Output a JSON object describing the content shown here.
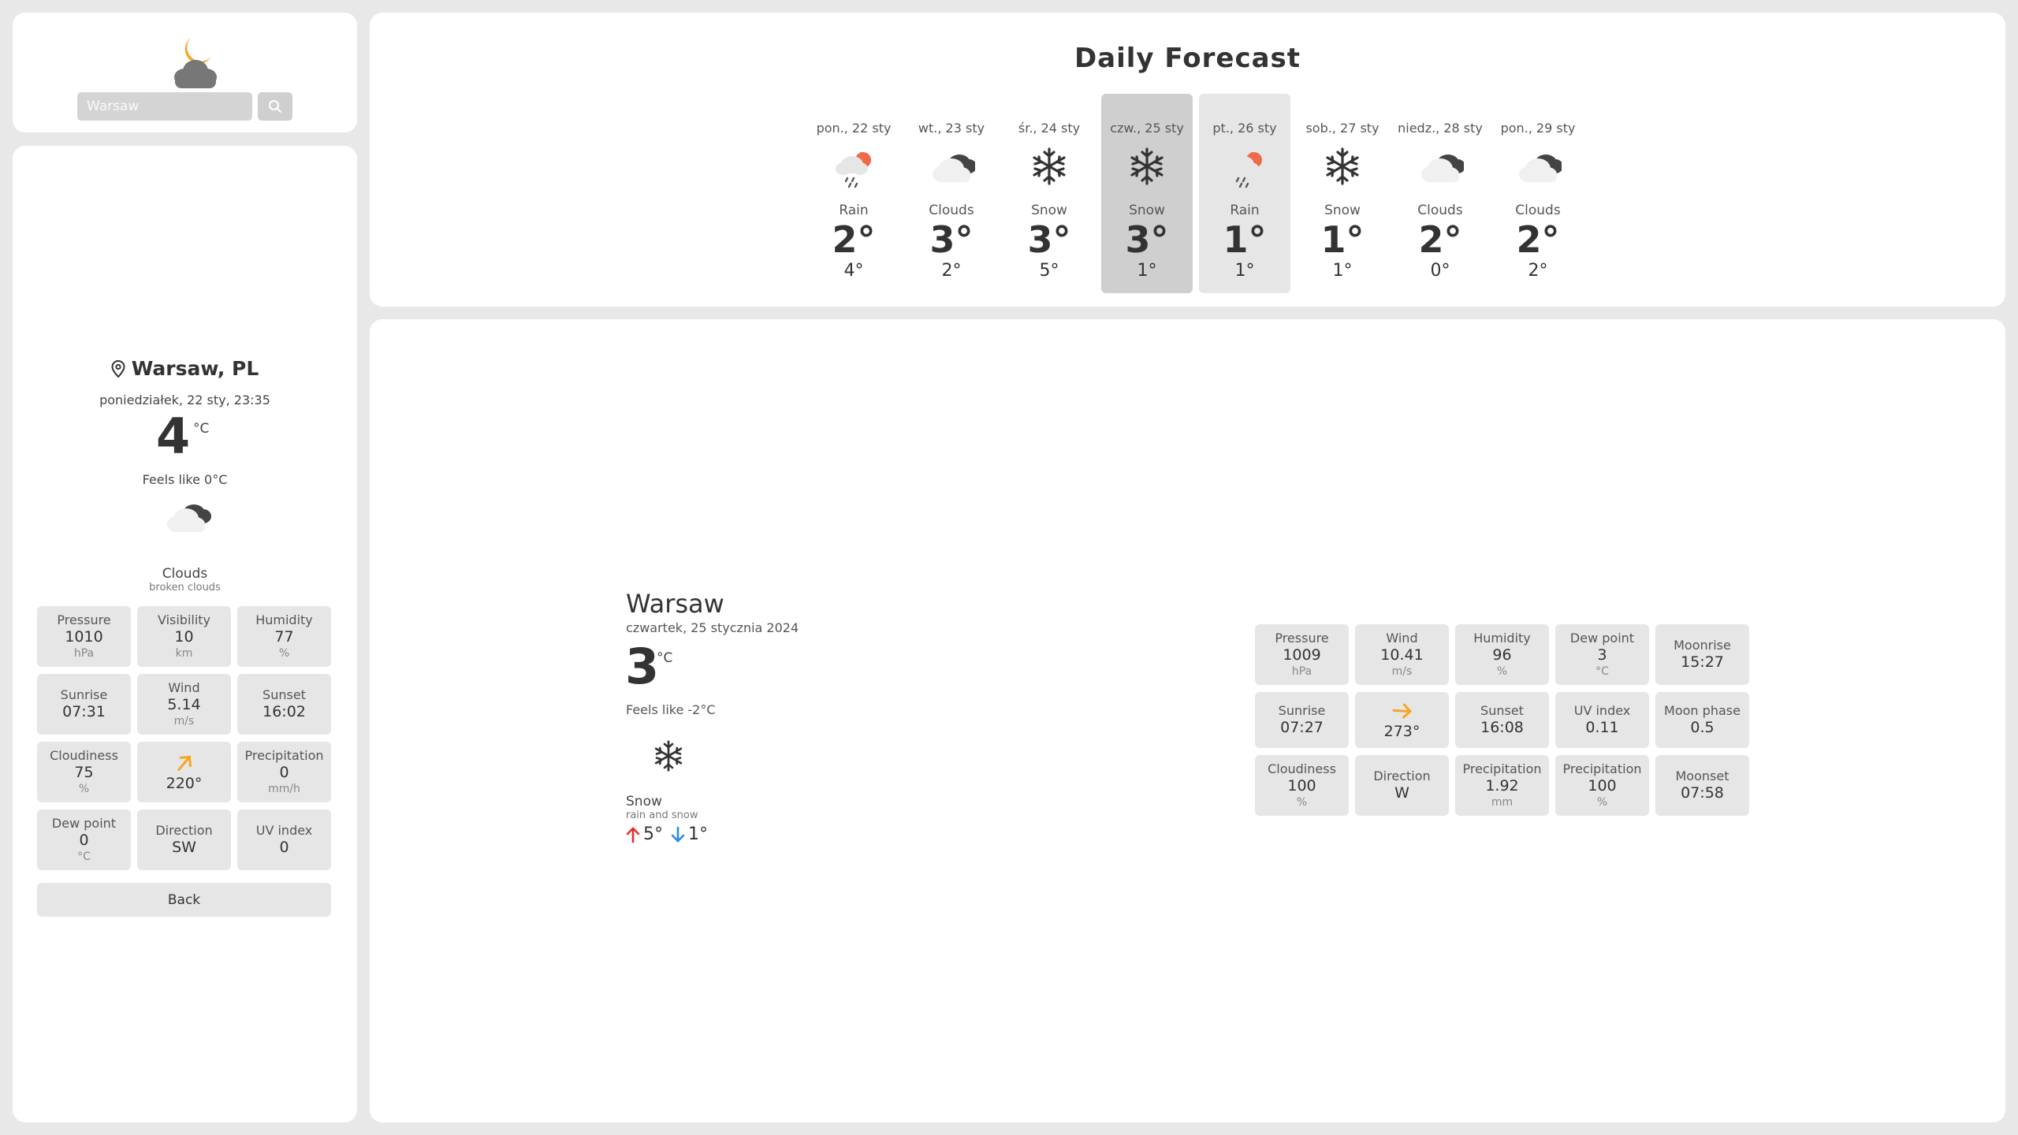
{
  "search": {
    "value": "",
    "placeholder": "Warsaw"
  },
  "current": {
    "city": "Warsaw, PL",
    "datetime": "poniedziałek, 22 sty, 23:35",
    "temp": "4",
    "unit": "°C",
    "feels_like": "Feels like 0°C",
    "icon": "broken-clouds-icon",
    "condition": "Clouds",
    "description": "broken clouds",
    "tiles": {
      "pressure": {
        "label": "Pressure",
        "value": "1010",
        "unit": "hPa"
      },
      "visibility": {
        "label": "Visibility",
        "value": "10",
        "unit": "km"
      },
      "humidity": {
        "label": "Humidity",
        "value": "77",
        "unit": "%"
      },
      "sunrise": {
        "label": "Sunrise",
        "value": "07:31"
      },
      "wind": {
        "label": "Wind",
        "value": "5.14",
        "unit": "m/s"
      },
      "sunset": {
        "label": "Sunset",
        "value": "16:02"
      },
      "cloudiness": {
        "label": "Cloudiness",
        "value": "75",
        "unit": "%"
      },
      "wind_deg": {
        "value": "220°",
        "arrow_deg": 220
      },
      "precipitation": {
        "label": "Precipitation",
        "value": "0",
        "unit": "mm/h"
      },
      "dew_point": {
        "label": "Dew point",
        "value": "0",
        "unit": "°C"
      },
      "direction": {
        "label": "Direction",
        "value": "SW"
      },
      "uv_index": {
        "label": "UV index",
        "value": "0"
      }
    },
    "back_label": "Back"
  },
  "forecast": {
    "title": "Daily Forecast",
    "days": [
      {
        "date": "pon., 22 sty",
        "icon": "rain-icon",
        "condition": "Rain",
        "max": "2°",
        "min": "4°",
        "state": ""
      },
      {
        "date": "wt., 23 sty",
        "icon": "clouds-icon",
        "condition": "Clouds",
        "max": "3°",
        "min": "2°",
        "state": ""
      },
      {
        "date": "śr., 24 sty",
        "icon": "snow-icon",
        "condition": "Snow",
        "max": "3°",
        "min": "5°",
        "state": ""
      },
      {
        "date": "czw., 25 sty",
        "icon": "snow-icon",
        "condition": "Snow",
        "max": "3°",
        "min": "1°",
        "state": "active"
      },
      {
        "date": "pt., 26 sty",
        "icon": "rain-icon",
        "condition": "Rain",
        "max": "1°",
        "min": "1°",
        "state": "hover"
      },
      {
        "date": "sob., 27 sty",
        "icon": "snow-icon",
        "condition": "Snow",
        "max": "1°",
        "min": "1°",
        "state": ""
      },
      {
        "date": "niedz., 28 sty",
        "icon": "clouds-icon",
        "condition": "Clouds",
        "max": "2°",
        "min": "0°",
        "state": ""
      },
      {
        "date": "pon., 29 sty",
        "icon": "clouds-icon",
        "condition": "Clouds",
        "max": "2°",
        "min": "2°",
        "state": ""
      }
    ]
  },
  "detail": {
    "city": "Warsaw",
    "date": "czwartek, 25 stycznia 2024",
    "temp": "3",
    "unit": "°C",
    "feels_like": "Feels like -2°C",
    "icon": "snow-icon",
    "condition": "Snow",
    "description": "rain and snow",
    "max": "5°",
    "min": "1°",
    "colors": {
      "max_arrow": "#e03030",
      "min_arrow": "#2a8ae0"
    },
    "tiles": {
      "pressure": {
        "label": "Pressure",
        "value": "1009",
        "unit": "hPa"
      },
      "wind": {
        "label": "Wind",
        "value": "10.41",
        "unit": "m/s"
      },
      "humidity": {
        "label": "Humidity",
        "value": "96",
        "unit": "%"
      },
      "dew_point": {
        "label": "Dew point",
        "value": "3",
        "unit": "°C"
      },
      "moonrise": {
        "label": "Moonrise",
        "value": "15:27"
      },
      "sunrise": {
        "label": "Sunrise",
        "value": "07:27"
      },
      "wind_deg": {
        "value": "273°",
        "arrow_deg": 273
      },
      "sunset": {
        "label": "Sunset",
        "value": "16:08"
      },
      "uv_index": {
        "label": "UV index",
        "value": "0.11"
      },
      "moon_phase": {
        "label": "Moon phase",
        "value": "0.5"
      },
      "cloudiness": {
        "label": "Cloudiness",
        "value": "100",
        "unit": "%"
      },
      "direction": {
        "label": "Direction",
        "value": "W"
      },
      "precipitation_mm": {
        "label": "Precipitation",
        "value": "1.92",
        "unit": "mm"
      },
      "precipitation_pct": {
        "label": "Precipitation",
        "value": "100",
        "unit": "%"
      },
      "moonset": {
        "label": "Moonset",
        "value": "07:58"
      }
    }
  },
  "colors": {
    "card_bg": "#ffffff",
    "page_bg": "#e8e8e8",
    "tile_bg": "#e6e6e6",
    "active_day_bg": "#cfcfcf",
    "wind_arrow": "#f5a623",
    "sun_orange": "#f5a623",
    "rain_sun": "#f06a4a"
  }
}
